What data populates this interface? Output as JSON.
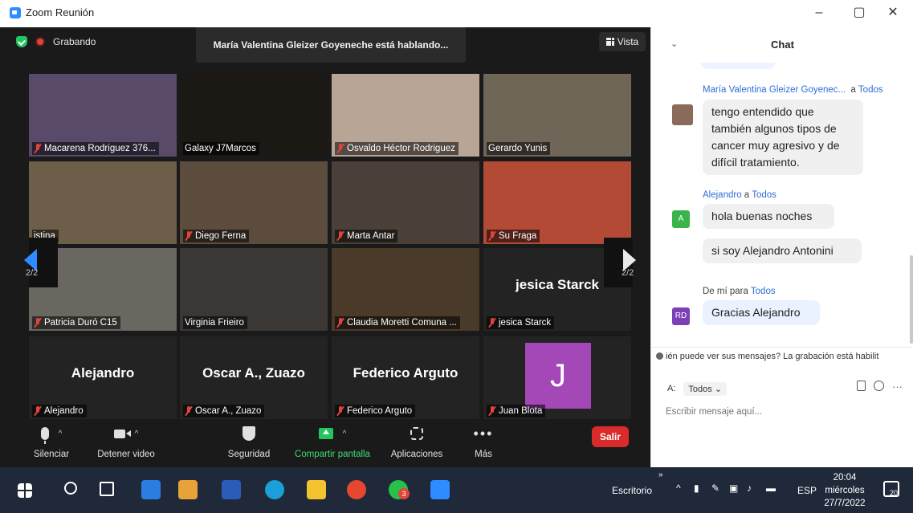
{
  "window": {
    "title": "Zoom Reunión",
    "min": "–",
    "max": "▢",
    "close": "✕"
  },
  "topbar": {
    "recording": "Grabando",
    "speaking": "María Valentina Gleizer Goyeneche está hablando...",
    "view_label": "Vista"
  },
  "tiles": [
    {
      "name": "Macarena Rodriguez 376...",
      "muted": true,
      "bg": "#5a4a6a"
    },
    {
      "name": "Galaxy J7Marcos",
      "muted": false,
      "bg": "#1c1814"
    },
    {
      "name": "Osvaldo Héctor Rodriguez",
      "muted": true,
      "bg": "#b9a596"
    },
    {
      "name": "Gerardo Yunis",
      "muted": false,
      "bg": "#6f6658"
    },
    {
      "name": "istina",
      "muted": false,
      "bg": "#6d5e4a"
    },
    {
      "name": "Diego Ferna",
      "muted": true,
      "bg": "#5b4c3e"
    },
    {
      "name": "Marta Antar",
      "muted": true,
      "bg": "#4a4039"
    },
    {
      "name": "Su Fraga",
      "muted": true,
      "bg": "#b24a36"
    },
    {
      "name": "Patricia Duró C15",
      "muted": true,
      "bg": "#6a6660"
    },
    {
      "name": "Virginia Frieiro",
      "muted": false,
      "bg": "#3a3735"
    },
    {
      "name": "Claudia Moretti Comuna ...",
      "muted": true,
      "bg": "#4a3a2a"
    },
    {
      "name": "jesica Starck",
      "muted": true,
      "bg": "#232323",
      "bigname": "jesica Starck"
    },
    {
      "name": "Alejandro",
      "muted": true,
      "bg": "#232323",
      "bigname": "Alejandro"
    },
    {
      "name": "Oscar A., Zuazo",
      "muted": true,
      "bg": "#232323",
      "bigname": "Oscar A., Zuazo"
    },
    {
      "name": "Federico Arguto",
      "muted": true,
      "bg": "#232323",
      "bigname": "Federico Arguto"
    },
    {
      "name": "Juan Blota",
      "muted": true,
      "bg": "#232323",
      "avatar": "J"
    }
  ],
  "pagination": {
    "left": "2/2",
    "right": "2/2"
  },
  "toolbar": {
    "mute": "Silenciar",
    "video": "Detener video",
    "security": "Seguridad",
    "share": "Compartir pantalla",
    "apps": "Aplicaciones",
    "more": "Más",
    "leave": "Salir"
  },
  "chat": {
    "title": "Chat",
    "messages": [
      {
        "sender": "María Valentina Gleizer Goyenec...",
        "to_word": "a",
        "to": "Todos",
        "text": "tengo entendido que también algunos tipos de cancer muy agresivo y de difícil tratamiento."
      },
      {
        "sender": "Alejandro",
        "to_word": "a",
        "to": "Todos",
        "text": "hola buenas noches",
        "avatar": "A"
      },
      {
        "text": "si soy Alejandro Antonini"
      },
      {
        "sender": "De mí",
        "to_word": "para",
        "to": "Todos",
        "text": "Gracias Alejandro",
        "avatar": "RD"
      }
    ],
    "privacy": "ién puede ver sus mensajes? La grabación está habilit",
    "to_label": "A:",
    "to_value": "Todos",
    "input_placeholder": "Escribir mensaje aquí..."
  },
  "taskbar": {
    "desktop": "Escritorio",
    "lang": "ESP",
    "time": "20:04",
    "day": "miércoles",
    "date": "27/7/2022",
    "notifications": "20",
    "whatsapp_badge": "3",
    "overflow": "»"
  },
  "colors": {
    "zoom_blue": "#2d8cff",
    "leave_red": "#d92b2b",
    "share_green": "#23c55e",
    "avatar_purple": "#a448b8",
    "avatar_green": "#3ab44a",
    "avatar_violet": "#7b3fb8"
  }
}
